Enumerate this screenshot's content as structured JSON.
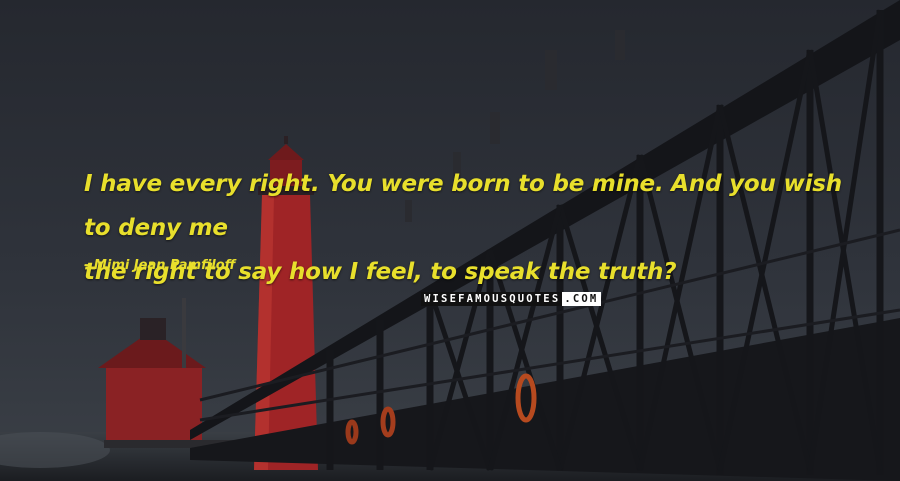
{
  "quote": {
    "line1": "I have every right. You were born to be mine. And you wish to deny me",
    "line2": "the right to say how I feel, to speak the truth?"
  },
  "author": "- Mimi Jean Pamfiloff",
  "brand": {
    "part1": "WISEFAMOUSQUOTES",
    "part2": ".COM"
  },
  "colors": {
    "text": "#e8df2c",
    "sky": "#2a2e36",
    "lighthouse": "#b3282a"
  }
}
